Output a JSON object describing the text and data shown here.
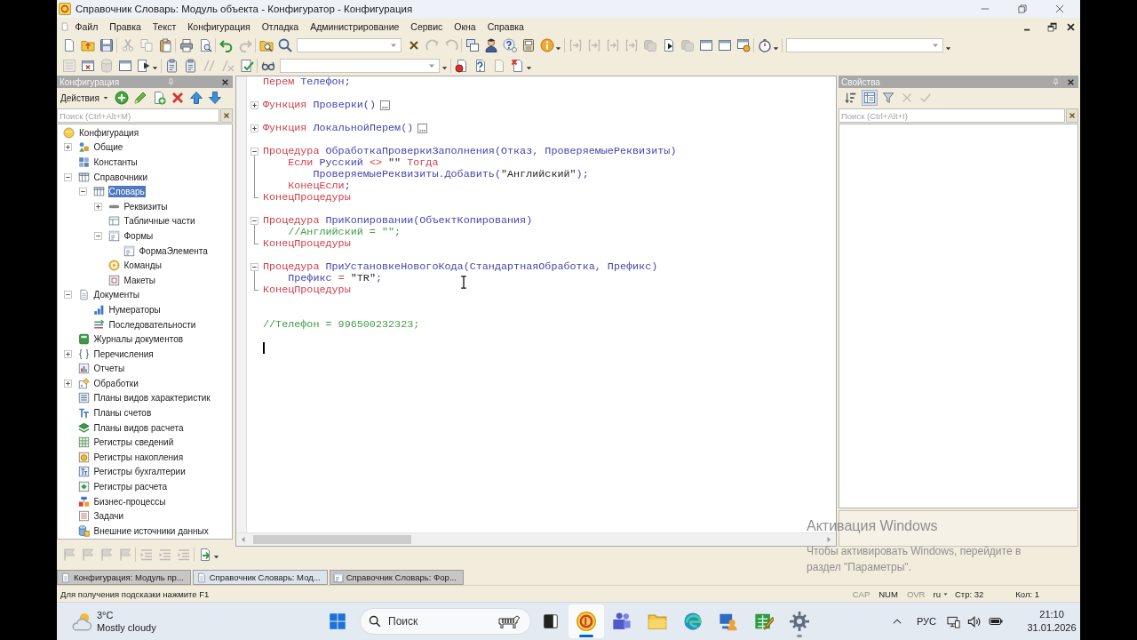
{
  "window": {
    "title": "Справочник Словарь: Модуль объекта - Конфигуратор - Конфигурация"
  },
  "menu": [
    "Файл",
    "Правка",
    "Текст",
    "Конфигурация",
    "Отладка",
    "Администрирование",
    "Сервис",
    "Окна",
    "Справка"
  ],
  "main_toolbar": {
    "buttons": [
      {
        "disabled": false
      },
      {
        "disabled": false
      },
      {
        "disabled": false
      },
      {
        "disabled": true
      },
      {
        "disabled": true
      },
      {
        "disabled": false
      },
      {
        "disabled": false
      },
      {
        "disabled": false
      },
      {
        "disabled": false
      },
      {
        "disabled": true
      },
      {
        "disabled": false
      },
      {
        "disabled": false
      },
      {
        "disabled": true
      },
      {
        "disabled": true
      },
      {
        "disabled": false
      },
      {
        "disabled": false
      },
      {
        "disabled": false
      },
      {
        "disabled": false
      },
      {
        "disabled": false
      },
      {
        "disabled": true
      },
      {
        "disabled": true
      },
      {
        "disabled": true
      },
      {
        "disabled": true
      },
      {
        "disabled": true
      },
      {
        "disabled": false
      },
      {
        "disabled": true
      },
      {
        "disabled": false
      },
      {
        "disabled": false
      },
      {
        "disabled": false
      },
      {
        "disabled": false
      }
    ]
  },
  "module_toolbar": {
    "buttons": [
      {
        "disabled": true
      },
      {
        "disabled": false
      },
      {
        "disabled": true
      },
      {
        "disabled": false
      },
      {
        "disabled": false
      },
      {
        "disabled": false
      },
      {
        "disabled": false
      },
      {
        "disabled": true
      },
      {
        "disabled": true
      },
      {
        "disabled": false
      },
      {
        "disabled": false
      },
      {
        "disabled": false
      },
      {
        "disabled": false
      },
      {
        "disabled": true
      },
      {
        "disabled": false
      }
    ]
  },
  "config_panel": {
    "title": "Конфигурация",
    "actions_label": "Действия",
    "search_placeholder": "Поиск (Ctrl+Alt+M)",
    "items": [
      {
        "label": "Конфигурация",
        "kind": "root",
        "selected": false,
        "children": [
          {
            "label": "Общие",
            "kind": "common",
            "expanded": false,
            "selected": false
          },
          {
            "label": "Константы",
            "kind": "constants",
            "selected": false
          },
          {
            "label": "Справочники",
            "kind": "catalogs",
            "expanded": true,
            "selected": false,
            "children": [
              {
                "label": "Словарь",
                "kind": "catalog",
                "expanded": true,
                "selected": true,
                "children": [
                  {
                    "label": "Реквизиты",
                    "kind": "attributes",
                    "expanded": false,
                    "selected": false
                  },
                  {
                    "label": "Табличные части",
                    "kind": "tabular",
                    "selected": false
                  },
                  {
                    "label": "Формы",
                    "kind": "forms",
                    "expanded": true,
                    "selected": false,
                    "children": [
                      {
                        "label": "ФормаЭлемента",
                        "kind": "form",
                        "selected": false
                      }
                    ]
                  },
                  {
                    "label": "Команды",
                    "kind": "commands",
                    "selected": false
                  },
                  {
                    "label": "Макеты",
                    "kind": "templates",
                    "selected": false
                  }
                ]
              }
            ]
          },
          {
            "label": "Документы",
            "kind": "documents",
            "expanded": true,
            "selected": false,
            "children": [
              {
                "label": "Нумераторы",
                "kind": "numerators",
                "selected": false
              },
              {
                "label": "Последовательности",
                "kind": "sequences",
                "selected": false
              }
            ]
          },
          {
            "label": "Журналы документов",
            "kind": "journals",
            "selected": false
          },
          {
            "label": "Перечисления",
            "kind": "enums",
            "expanded": false,
            "selected": false
          },
          {
            "label": "Отчеты",
            "kind": "reports",
            "selected": false
          },
          {
            "label": "Обработки",
            "kind": "processors",
            "expanded": false,
            "selected": false
          },
          {
            "label": "Планы видов характеристик",
            "kind": "charplans",
            "selected": false
          },
          {
            "label": "Планы счетов",
            "kind": "accounts",
            "selected": false
          },
          {
            "label": "Планы видов расчета",
            "kind": "calcplans",
            "selected": false
          },
          {
            "label": "Регистры сведений",
            "kind": "inforegs",
            "selected": false
          },
          {
            "label": "Регистры накопления",
            "kind": "accumregs",
            "selected": false
          },
          {
            "label": "Регистры бухгалтерии",
            "kind": "accregs",
            "selected": false
          },
          {
            "label": "Регистры расчета",
            "kind": "calcregs",
            "selected": false
          },
          {
            "label": "Бизнес-процессы",
            "kind": "processes",
            "selected": false
          },
          {
            "label": "Задачи",
            "kind": "tasks",
            "selected": false
          },
          {
            "label": "Внешние источники данных",
            "kind": "external",
            "selected": false
          }
        ]
      }
    ],
    "bottom_toolbar": {
      "buttons": [
        {
          "disabled": true
        },
        {
          "disabled": true
        },
        {
          "disabled": true
        },
        {
          "disabled": true
        },
        {
          "disabled": true
        },
        {
          "disabled": true
        },
        {
          "disabled": true
        },
        {
          "disabled": false
        }
      ]
    }
  },
  "editor": {
    "lines": [
      {
        "kind": "plain",
        "tokens": [
          {
            "text": "Перем ",
            "kind": "kw"
          },
          {
            "text": "Телефон",
            "kind": "id"
          },
          {
            "text": ";",
            "kind": "punct"
          }
        ]
      },
      {
        "kind": "plain"
      },
      {
        "kind": "collapsed",
        "tokens": [
          {
            "text": "Функция ",
            "kind": "kw"
          },
          {
            "text": "Проверки",
            "kind": "id"
          },
          {
            "text": "()",
            "kind": "punct"
          }
        ]
      },
      {
        "kind": "plain"
      },
      {
        "kind": "collapsed",
        "tokens": [
          {
            "text": "Функция ",
            "kind": "kw"
          },
          {
            "text": "ЛокальнойПерем",
            "kind": "id"
          },
          {
            "text": "()",
            "kind": "punct"
          }
        ]
      },
      {
        "kind": "plain"
      },
      {
        "kind": "start",
        "tokens": [
          {
            "text": "Процедура ",
            "kind": "kw"
          },
          {
            "text": "ОбработкаПроверкиЗаполнения",
            "kind": "id"
          },
          {
            "text": "(",
            "kind": "punct"
          },
          {
            "text": "Отказ",
            "kind": "id"
          },
          {
            "text": ", ",
            "kind": "punct"
          },
          {
            "text": "ПроверяемыеРеквизиты",
            "kind": "id"
          },
          {
            "text": ")",
            "kind": "punct"
          }
        ]
      },
      {
        "kind": "inner",
        "tokens": [
          {
            "text": "    Если ",
            "kind": "kw"
          },
          {
            "text": "Русский ",
            "kind": "id"
          },
          {
            "text": "<> ",
            "kind": "op"
          },
          {
            "text": "\"\" ",
            "kind": "str"
          },
          {
            "text": "Тогда",
            "kind": "kw"
          }
        ]
      },
      {
        "kind": "inner",
        "tokens": [
          {
            "text": "        ПроверяемыеРеквизиты",
            "kind": "id"
          },
          {
            "text": ".",
            "kind": "punct"
          },
          {
            "text": "Добавить",
            "kind": "id"
          },
          {
            "text": "(",
            "kind": "punct"
          },
          {
            "text": "\"Английский\"",
            "kind": "str"
          },
          {
            "text": ");",
            "kind": "punct"
          }
        ]
      },
      {
        "kind": "inner",
        "tokens": [
          {
            "text": "    КонецЕсли",
            "kind": "kw"
          },
          {
            "text": ";",
            "kind": "punct"
          }
        ]
      },
      {
        "kind": "end",
        "tokens": [
          {
            "text": "КонецПроцедуры",
            "kind": "kw"
          }
        ]
      },
      {
        "kind": "plain"
      },
      {
        "kind": "start",
        "tokens": [
          {
            "text": "Процедура ",
            "kind": "kw"
          },
          {
            "text": "ПриКопировании",
            "kind": "id"
          },
          {
            "text": "(",
            "kind": "punct"
          },
          {
            "text": "ОбъектКопирования",
            "kind": "id"
          },
          {
            "text": ")",
            "kind": "punct"
          }
        ]
      },
      {
        "kind": "inner",
        "tokens": [
          {
            "text": "    //Английский = \"\";",
            "kind": "cmt"
          }
        ]
      },
      {
        "kind": "end",
        "tokens": [
          {
            "text": "КонецПроцедуры",
            "kind": "kw"
          }
        ]
      },
      {
        "kind": "plain"
      },
      {
        "kind": "start",
        "tokens": [
          {
            "text": "Процедура ",
            "kind": "kw"
          },
          {
            "text": "ПриУстановкеНовогоКода",
            "kind": "id"
          },
          {
            "text": "(",
            "kind": "punct"
          },
          {
            "text": "СтандартнаяОбработка",
            "kind": "id"
          },
          {
            "text": ", ",
            "kind": "punct"
          },
          {
            "text": "Префикс",
            "kind": "id"
          },
          {
            "text": ")",
            "kind": "punct"
          }
        ]
      },
      {
        "kind": "inner",
        "tokens": [
          {
            "text": "    Префикс ",
            "kind": "id"
          },
          {
            "text": "= ",
            "kind": "op"
          },
          {
            "text": "\"TR\"",
            "kind": "str"
          },
          {
            "text": ";",
            "kind": "punct"
          }
        ]
      },
      {
        "kind": "end",
        "tokens": [
          {
            "text": "КонецПроцедуры",
            "kind": "kw"
          }
        ]
      },
      {
        "kind": "plain"
      },
      {
        "kind": "plain"
      },
      {
        "kind": "plain",
        "tokens": [
          {
            "text": "//Телефон = 996500232323;",
            "kind": "cmt"
          }
        ]
      },
      {
        "kind": "plain"
      },
      {
        "kind": "cursor"
      }
    ]
  },
  "properties_panel": {
    "title": "Свойства",
    "tools": [
      {
        "pressed": false,
        "disabled": false
      },
      {
        "pressed": true,
        "disabled": false
      },
      {
        "pressed": false,
        "disabled": false
      },
      {
        "pressed": false,
        "disabled": true
      },
      {
        "pressed": false,
        "disabled": true
      }
    ],
    "search_placeholder": "Поиск (Ctrl+Alt+I)"
  },
  "window_tabs": [
    {
      "label": "Конфигурация: Модуль пр...",
      "kind": "module",
      "selected": false
    },
    {
      "label": "Справочник Словарь: Мод...",
      "kind": "module",
      "selected": true
    },
    {
      "label": "Справочник Словарь: Фор...",
      "kind": "form",
      "selected": false
    }
  ],
  "status_bar": {
    "hint": "Для получения подсказки нажмите F1",
    "indicators": [
      {
        "label": "CAP",
        "on": false
      },
      {
        "label": "NUM",
        "on": true
      },
      {
        "label": "OVR",
        "on": false
      }
    ],
    "language": "ru",
    "line": "Стр: 32",
    "column": "Кол: 1"
  },
  "taskbar": {
    "weather": {
      "temperature": "3°C",
      "condition": "Mostly cloudy"
    },
    "search_placeholder": "Поиск",
    "apps": [
      {
        "active": true,
        "running": true
      },
      {
        "active": false,
        "running": false
      },
      {
        "active": false,
        "running": false
      },
      {
        "active": false,
        "running": false
      },
      {
        "active": false,
        "running": false
      },
      {
        "active": false,
        "running": false
      },
      {
        "active": false,
        "running": true
      }
    ],
    "language": "РУС",
    "time": "21:10",
    "date": "31.01.2026"
  },
  "activation_notice": {
    "title": "Активация Windows",
    "message": "Чтобы активировать Windows, перейдите в раздел \"Параметры\"."
  }
}
